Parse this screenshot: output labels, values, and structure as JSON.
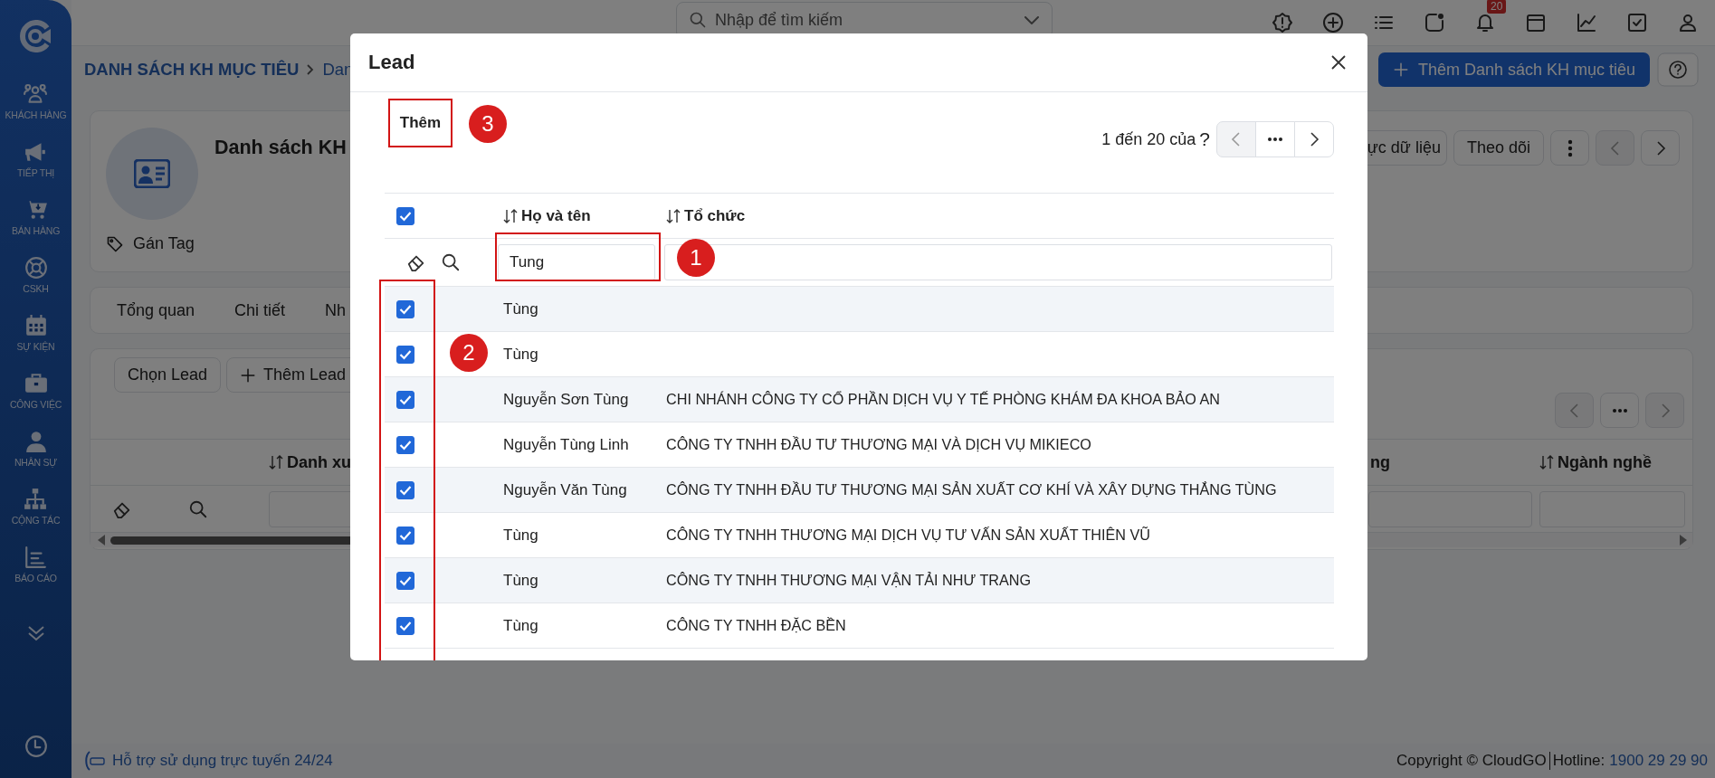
{
  "sidebar": {
    "items": [
      {
        "label": "KHÁCH HÀNG"
      },
      {
        "label": "TIẾP THỊ"
      },
      {
        "label": "BÁN HÀNG"
      },
      {
        "label": "CSKH"
      },
      {
        "label": "SỰ KIỆN"
      },
      {
        "label": "CÔNG VIỆC"
      },
      {
        "label": "NHÂN SỰ"
      },
      {
        "label": "CỘNG TÁC"
      },
      {
        "label": "BÁO CÁO"
      }
    ]
  },
  "topbar": {
    "search": {
      "placeholder": "Nhập để tìm kiếm"
    },
    "notification_count": "20"
  },
  "breadcrumb": [
    "DANH SÁCH KH MỤC TIÊU",
    "Dan"
  ],
  "header_buttons": [
    "Thêm Danh sách KH mục tiêu"
  ],
  "record": {
    "title": "Danh sách KH",
    "tag_label": "Gán Tag",
    "actions": [
      "ực dữ liệu",
      "Theo dõi"
    ]
  },
  "tabs": [
    "Tổng quan",
    "Chi tiết",
    "Nh"
  ],
  "lead_section": {
    "buttons": [
      "Chọn Lead",
      "Thêm Lead"
    ],
    "columns": [
      "Danh xu",
      "ng",
      "Ngành nghề"
    ]
  },
  "modal": {
    "title": "Lead",
    "add_button": "Thêm",
    "pagination": "1 đến 20 của",
    "pagination_help": "?",
    "select_all": true,
    "columns": [
      "Họ và tên",
      "Tổ chức"
    ],
    "name_filter": "Tung",
    "rows": [
      {
        "name": "Tùng",
        "checked": true
      },
      {
        "name": "Tùng",
        "checked": true
      },
      {
        "name": "Nguyễn Sơn Tùng",
        "organization": "CHI NHÁNH CÔNG TY CỔ PHẦN DỊCH VỤ Y TẾ PHÒNG KHÁM ĐA KHOA BẢO AN",
        "checked": true
      },
      {
        "name": "Nguyễn Tùng Linh",
        "organization": "CÔNG TY TNHH ĐẦU TƯ THƯƠNG MẠI VÀ DỊCH VỤ MIKIECO",
        "checked": true
      },
      {
        "name": "Nguyễn Văn Tùng",
        "organization": "CÔNG TY TNHH ĐẦU TƯ THƯƠNG MẠI SẢN XUẤT CƠ KHÍ VÀ XÂY DỰNG THẮNG TÙNG",
        "checked": true
      },
      {
        "name": "Tùng",
        "organization": "CÔNG TY TNHH THƯƠNG MẠI DỊCH VỤ TƯ VẤN SẢN XUẤT THIÊN VŨ",
        "checked": true
      },
      {
        "name": "Tùng",
        "organization": "CÔNG TY TNHH THƯƠNG MẠI VẬN TẢI NHƯ TRANG",
        "checked": true
      },
      {
        "name": "Tùng",
        "organization": "CÔNG TY TNHH ĐẶC BỀN",
        "checked": true
      }
    ]
  },
  "annotations": [
    {
      "number": "3"
    },
    {
      "number": "1"
    },
    {
      "number": "2"
    }
  ],
  "footer": {
    "support": "Hỗ trợ sử dụng trực tuyến 24/24",
    "copyright": "Copyright © CloudGO",
    "hotline_label": "Hotline:",
    "hotline": "1900 29 29 90"
  }
}
